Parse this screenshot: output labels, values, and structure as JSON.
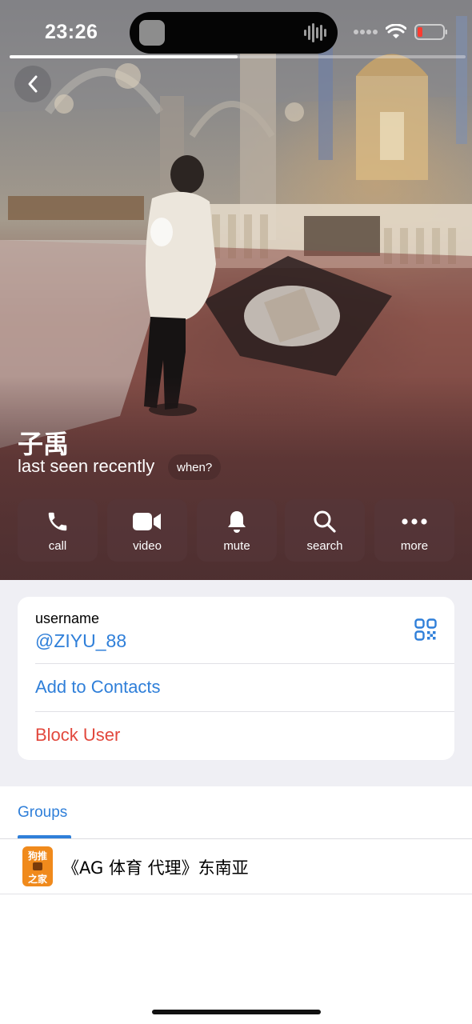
{
  "status_bar": {
    "time": "23:26",
    "icons": [
      "cellular-dots-icon",
      "wifi-icon",
      "battery-low-icon"
    ]
  },
  "story_progress": 0.5,
  "profile": {
    "name": "子禹",
    "last_seen": "last seen recently",
    "when_label": "when?"
  },
  "actions": [
    {
      "label": "call",
      "icon": "phone-icon"
    },
    {
      "label": "video",
      "icon": "video-camera-icon"
    },
    {
      "label": "mute",
      "icon": "bell-icon"
    },
    {
      "label": "search",
      "icon": "search-icon"
    },
    {
      "label": "more",
      "icon": "more-dots-icon"
    }
  ],
  "info": {
    "username_label": "username",
    "username_value": "@ZIYU_88",
    "add_contacts": "Add to Contacts",
    "block_user": "Block User"
  },
  "groups": {
    "tab_label": "Groups",
    "items": [
      {
        "name": "《AG 体育 代理》东南亚",
        "avatar_text_top": "狗推",
        "avatar_text_bottom": "之家"
      }
    ]
  },
  "colors": {
    "accent": "#2f7fd9",
    "destructive": "#e2483d",
    "avatar_orange": "#f08a1c"
  }
}
